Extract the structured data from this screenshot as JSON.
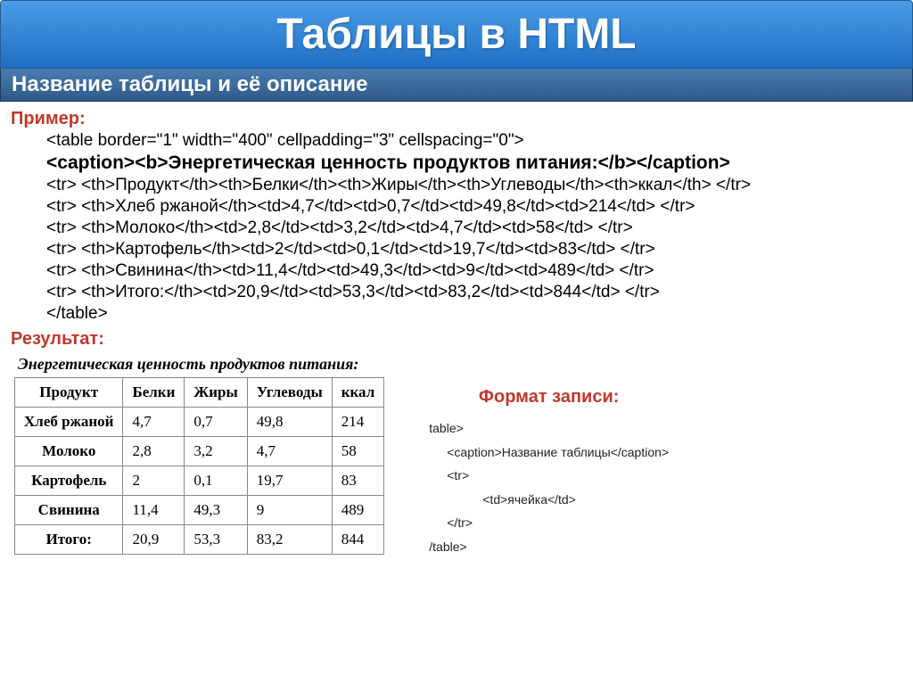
{
  "title": "Таблицы в HTML",
  "subtitle": "Название таблицы и её описание",
  "example_label": "Пример:",
  "code_lines": [
    {
      "t": "<table border=\"1\" width=\"400\" cellpadding=\"3\" cellspacing=\"0\">",
      "bold": false
    },
    {
      "t": "<caption><b>Энергетическая ценность продуктов питания:</b></caption>",
      "bold": true
    },
    {
      "t": "<tr> <th>Продукт</th><th>Белки</th><th>Жиры</th><th>Углеводы</th><th>ккал</th> </tr>",
      "bold": false
    },
    {
      "t": "<tr> <th>Хлеб ржаной</th><td>4,7</td><td>0,7</td><td>49,8</td><td>214</td> </tr>",
      "bold": false
    },
    {
      "t": "<tr> <th>Молоко</th><td>2,8</td><td>3,2</td><td>4,7</td><td>58</td> </tr>",
      "bold": false
    },
    {
      "t": "<tr> <th>Картофель</th><td>2</td><td>0,1</td><td>19,7</td><td>83</td> </tr>",
      "bold": false
    },
    {
      "t": "<tr> <th>Свинина</th><td>11,4</td><td>49,3</td><td>9</td><td>489</td> </tr>",
      "bold": false
    },
    {
      "t": "<tr> <th>Итого:</th><td>20,9</td><td>53,3</td><td>83,2</td><td>844</td> </tr>",
      "bold": false
    },
    {
      "t": "</table>",
      "bold": false
    }
  ],
  "result_label": "Результат:",
  "table_caption": "Энергетическая ценность продуктов питания:",
  "table_headers": [
    "Продукт",
    "Белки",
    "Жиры",
    "Углеводы",
    "ккал"
  ],
  "table_rows": [
    {
      "name": "Хлеб ржаной",
      "cells": [
        "4,7",
        "0,7",
        "49,8",
        "214"
      ]
    },
    {
      "name": "Молоко",
      "cells": [
        "2,8",
        "3,2",
        "4,7",
        "58"
      ]
    },
    {
      "name": "Картофель",
      "cells": [
        "2",
        "0,1",
        "19,7",
        "83"
      ]
    },
    {
      "name": "Свинина",
      "cells": [
        "11,4",
        "49,3",
        "9",
        "489"
      ]
    },
    {
      "name": "Итого:",
      "cells": [
        "20,9",
        "53,3",
        "83,2",
        "844"
      ]
    }
  ],
  "format_heading": "Формат записи:",
  "format_lines": [
    {
      "cls": "l1",
      "t": "table>"
    },
    {
      "cls": "l2",
      "t": "<caption>Название таблицы</caption>"
    },
    {
      "cls": "l2",
      "t": "<tr>"
    },
    {
      "cls": "l4",
      "t": "<td>ячейка</td>"
    },
    {
      "cls": "l2",
      "t": "</tr>"
    },
    {
      "cls": "l1",
      "t": "/table>"
    }
  ]
}
